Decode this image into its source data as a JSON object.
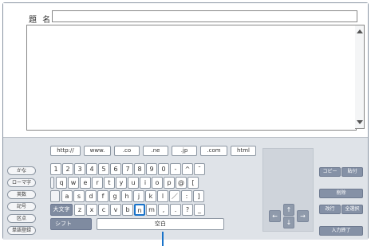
{
  "title_label": "題 名",
  "title_value": "",
  "body_value": "",
  "url_keys": [
    "http://",
    "www.",
    ".co",
    ".ne",
    ".jp",
    ".com",
    "html"
  ],
  "mode_keys": [
    "かな",
    "ローマ字",
    "英数",
    "記号",
    "区点",
    "単語登録"
  ],
  "row1": [
    "1",
    "2",
    "3",
    "4",
    "5",
    "6",
    "7",
    "8",
    "9",
    "0",
    "-",
    "^",
    "¯"
  ],
  "row2": [
    "q",
    "w",
    "e",
    "r",
    "t",
    "y",
    "u",
    "i",
    "o",
    "p",
    "@",
    "["
  ],
  "row3": [
    "a",
    "s",
    "d",
    "f",
    "g",
    "h",
    "j",
    "k",
    "l",
    "／",
    ":",
    "]"
  ],
  "row4": [
    "z",
    "x",
    "c",
    "v",
    "b",
    "n",
    "m",
    ",",
    ".",
    "?",
    "_"
  ],
  "caps_label": "大文字",
  "shift_label": "シフト",
  "space_label": "空白",
  "copy_label": "コピー",
  "paste_label": "貼付",
  "delete_label": "削除",
  "newline_label": "改行",
  "select_all_label": "全選択",
  "done_label": "入力終了",
  "arrows": {
    "up": "↑",
    "down": "↓",
    "left": "←",
    "right": "→"
  },
  "selected_key": "n",
  "colors": {
    "accent": "#1a73c9",
    "key_dark": "#7f8ba0",
    "panel_bg": "#dfe3e8"
  }
}
